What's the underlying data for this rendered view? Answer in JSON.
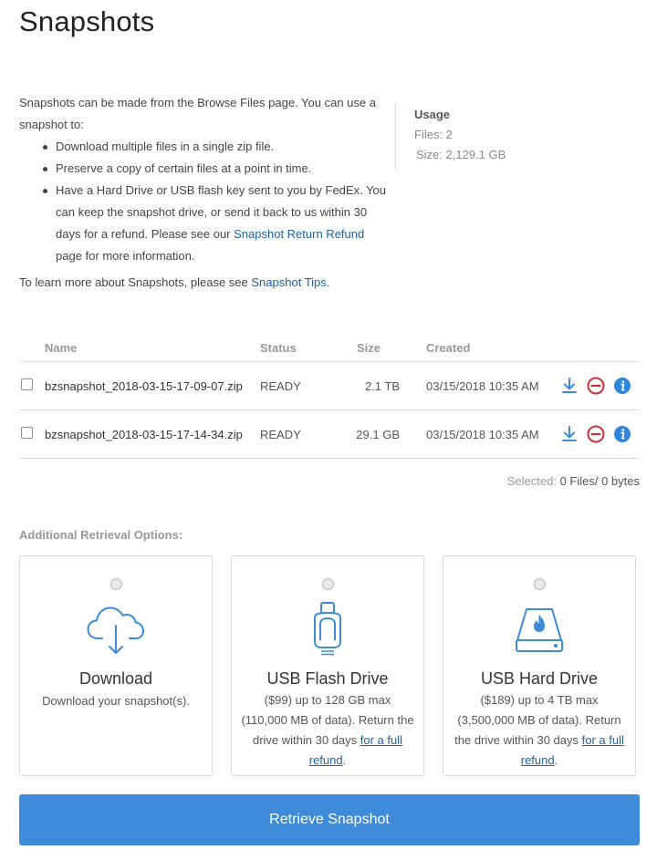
{
  "page": {
    "title": "Snapshots"
  },
  "intro": {
    "line1": "Snapshots can be made from the Browse Files page. You can use a snapshot to:",
    "bullets": [
      "Download multiple files in a single zip file.",
      "Preserve a copy of certain files at a point in time."
    ],
    "bullet3_text": "Have a Hard Drive or USB flash key sent to you by FedEx. You can keep the snapshot drive, or send it back to us within 30 days for a refund. Please see our ",
    "bullet3_link": "Snapshot Return Refund",
    "bullet3_tail": " page for more information.",
    "learn_text": "To learn more about Snapshots, please see ",
    "learn_link": "Snapshot Tips",
    "learn_tail": "."
  },
  "usage": {
    "title": "Usage",
    "files_label": "Files: ",
    "files_value": "2",
    "size_label": "Size: ",
    "size_value": "2,129.1 GB"
  },
  "table": {
    "headers": {
      "name": "Name",
      "status": "Status",
      "size": "Size",
      "created": "Created"
    },
    "rows": [
      {
        "name": "bzsnapshot_2018-03-15-17-09-07.zip",
        "status": "READY",
        "size": "2.1 TB",
        "created": "03/15/2018 10:35 AM"
      },
      {
        "name": "bzsnapshot_2018-03-15-17-14-34.zip",
        "status": "READY",
        "size": "29.1 GB",
        "created": "03/15/2018 10:35 AM"
      }
    ]
  },
  "selection": {
    "label": "Selected: ",
    "value": "0 Files/ 0 bytes"
  },
  "retrieval": {
    "heading": "Additional Retrieval Options:",
    "options": [
      {
        "title": "Download",
        "desc": "Download your snapshot(s).",
        "icon": "cloud-download-icon"
      },
      {
        "title": "USB Flash Drive",
        "desc": "($99) up to 128 GB max (110,000 MB of data). Return the drive within 30 days ",
        "link": "for a full refund",
        "tail": ".",
        "icon": "usb-flash-drive-icon"
      },
      {
        "title": "USB Hard Drive",
        "desc": "($189) up to 4 TB max (3,500,000 MB of data). Return the drive within 30 days ",
        "link": "for a full refund",
        "tail": ".",
        "icon": "hard-drive-icon"
      }
    ]
  },
  "actions": {
    "retrieve_label": "Retrieve Snapshot"
  },
  "colors": {
    "accent": "#3d8bd9",
    "link": "#1f5fa8",
    "danger": "#c9343a",
    "info": "#2f86d9"
  }
}
